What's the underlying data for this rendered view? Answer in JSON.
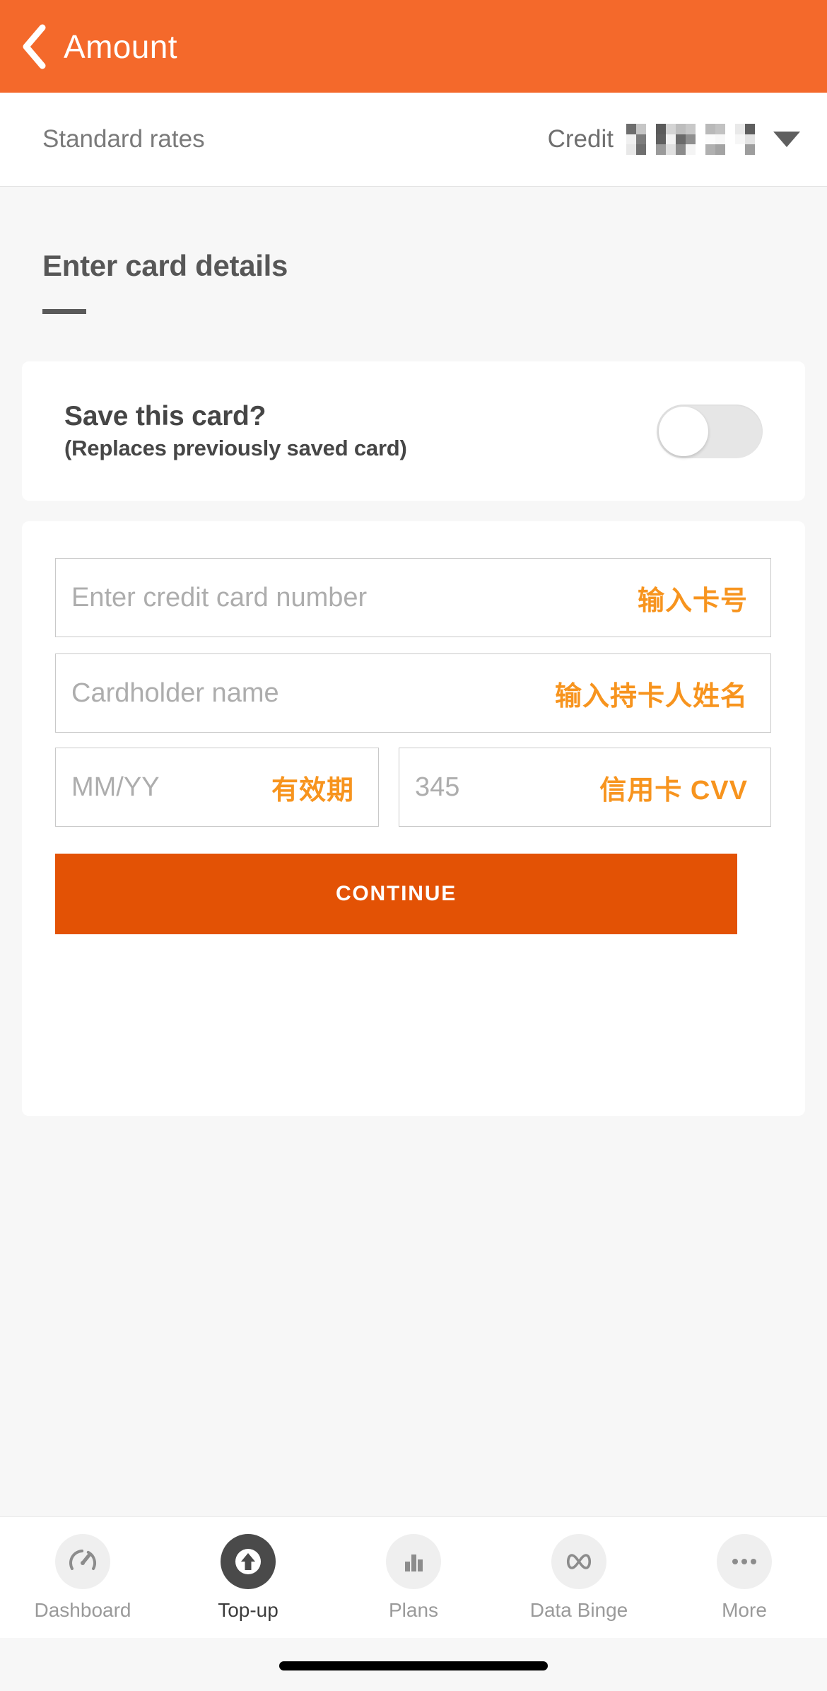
{
  "header": {
    "title": "Amount",
    "back_icon": "chevron-left-icon",
    "background_color": "#F4692B"
  },
  "rate_row": {
    "label": "Standard rates",
    "payment_method": "Credit",
    "redacted_value": "█████",
    "dropdown_icon": "caret-down-icon"
  },
  "section": {
    "title": "Enter card details"
  },
  "save_card": {
    "title": "Save this card?",
    "subtitle": "(Replaces previously saved card)",
    "toggle_state": "off"
  },
  "form": {
    "fields": [
      {
        "name": "card-number",
        "placeholder": "Enter credit card number",
        "hint_cn": "输入卡号",
        "value": ""
      },
      {
        "name": "cardholder-name",
        "placeholder": "Cardholder name",
        "hint_cn": "输入持卡人姓名",
        "value": ""
      },
      {
        "name": "expiry",
        "placeholder": "MM/YY",
        "hint_cn": "有效期",
        "value": ""
      },
      {
        "name": "cvv",
        "placeholder": "345",
        "hint_cn": "信用卡 CVV",
        "value": ""
      }
    ],
    "continue_label": "CONTINUE",
    "continue_color": "#E35205"
  },
  "bottom_nav": {
    "items": [
      {
        "label": "Dashboard",
        "icon": "speedometer-icon",
        "active": false
      },
      {
        "label": "Top-up",
        "icon": "arrow-up-circle-icon",
        "active": true
      },
      {
        "label": "Plans",
        "icon": "bar-chart-icon",
        "active": false
      },
      {
        "label": "Data Binge",
        "icon": "infinity-icon",
        "active": false
      },
      {
        "label": "More",
        "icon": "ellipsis-icon",
        "active": false
      }
    ]
  },
  "colors": {
    "brand_orange": "#F4692B",
    "accent_orange": "#F7941E",
    "button_orange": "#E35205",
    "page_background": "#F7F7F7"
  }
}
